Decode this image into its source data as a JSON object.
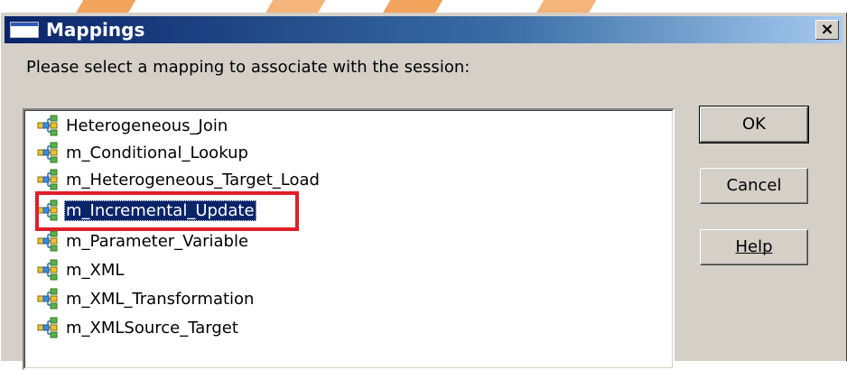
{
  "dialog": {
    "title": "Mappings",
    "close_label": "×",
    "prompt": "Please select a mapping to associate with the session:"
  },
  "mappings": [
    {
      "label": "Heterogeneous_Join",
      "selected": false
    },
    {
      "label": "m_Conditional_Lookup",
      "selected": false
    },
    {
      "label": "m_Heterogeneous_Target_Load",
      "selected": false
    },
    {
      "label": "m_Incremental_Update",
      "selected": true
    },
    {
      "label": "m_Parameter_Variable",
      "selected": false
    },
    {
      "label": "m_XML",
      "selected": false
    },
    {
      "label": "m_XML_Transformation",
      "selected": false
    },
    {
      "label": "m_XMLSource_Target",
      "selected": false
    }
  ],
  "buttons": {
    "ok": "OK",
    "cancel": "Cancel",
    "help": "Help"
  },
  "colors": {
    "selection": "#0a246a",
    "annotation_box": "#e01e2a",
    "watermark": "#f4a460"
  },
  "icons": {
    "title": "window-icon",
    "mapping": "mapping-icon"
  }
}
